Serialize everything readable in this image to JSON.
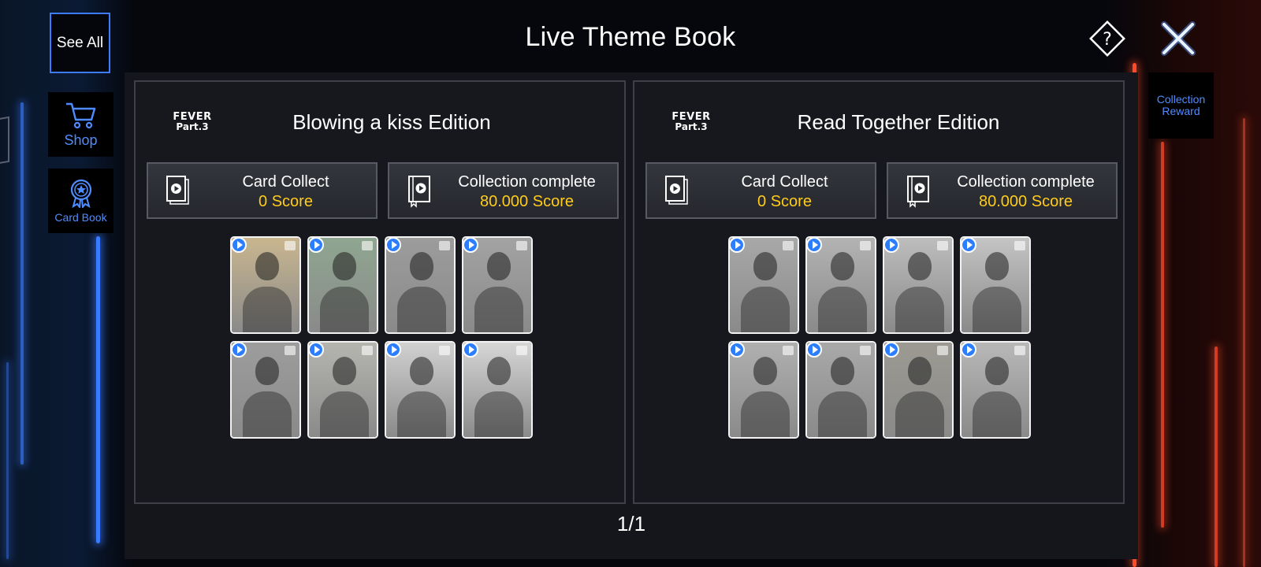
{
  "header": {
    "see_all_label": "See All",
    "title": "Live Theme Book",
    "help_icon": "question-diamond-icon",
    "close_icon": "close-x-icon"
  },
  "nav": {
    "shop_label": "Shop",
    "shop_icon": "cart-icon",
    "cardbook_label": "Card Book",
    "cardbook_icon": "badge-star-icon"
  },
  "reward": {
    "label": "Collection Reward"
  },
  "editions": [
    {
      "logo_line1": "FEVER",
      "logo_line2": "Part.3",
      "title": "Blowing a kiss Edition",
      "card_collect": {
        "label": "Card Collect",
        "score": "0 Score"
      },
      "collection_complete": {
        "label": "Collection complete",
        "score": "80.000 Score"
      },
      "cards": [
        {
          "tone": "#c9b68f"
        },
        {
          "tone": "#8fa690"
        },
        {
          "tone": "#9c9c9c"
        },
        {
          "tone": "#a3a3a3"
        },
        {
          "tone": "#9d9d9d"
        },
        {
          "tone": "#b5b5b0"
        },
        {
          "tone": "#d1d1d1"
        },
        {
          "tone": "#d6d6d6"
        }
      ]
    },
    {
      "logo_line1": "FEVER",
      "logo_line2": "Part.3",
      "title": "Read Together Edition",
      "card_collect": {
        "label": "Card Collect",
        "score": "0 Score"
      },
      "collection_complete": {
        "label": "Collection complete",
        "score": "80.000 Score"
      },
      "cards": [
        {
          "tone": "#a8a8a8"
        },
        {
          "tone": "#b3b3b3"
        },
        {
          "tone": "#bdbdbd"
        },
        {
          "tone": "#c4c4c4"
        },
        {
          "tone": "#b0b0b0"
        },
        {
          "tone": "#a9a9a9"
        },
        {
          "tone": "#9c9a92"
        },
        {
          "tone": "#b8b8b8"
        }
      ]
    }
  ],
  "pager": {
    "text": "1/1"
  },
  "colors": {
    "accent": "#4f8cff",
    "score": "#ffcc1a"
  }
}
